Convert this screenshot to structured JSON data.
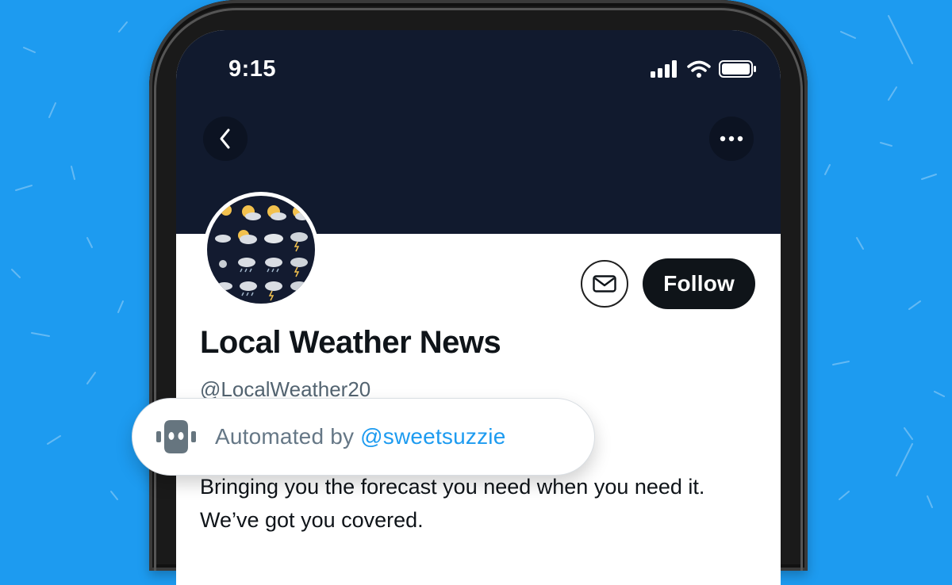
{
  "status_bar": {
    "time": "9:15",
    "icons": [
      "signal-icon",
      "wifi-icon",
      "battery-icon"
    ]
  },
  "nav": {
    "back_icon": "chevron-left-icon",
    "more_icon": "more-horizontal-icon"
  },
  "profile": {
    "display_name": "Local Weather News",
    "handle": "@LocalWeather20",
    "bio": "Bringing you the forecast you need when you need it.  We’ve got you covered.",
    "avatar_icon": "weather-icons-grid"
  },
  "actions": {
    "message_icon": "envelope-icon",
    "follow_label": "Follow"
  },
  "automated_label": {
    "prefix": "Automated by ",
    "account": "@sweetsuzzie",
    "icon": "robot-icon"
  },
  "colors": {
    "background": "#1d9bf0",
    "header": "#111a2e",
    "follow_button": "#0f1419",
    "link": "#1d9bf0",
    "secondary_text": "#536471"
  }
}
